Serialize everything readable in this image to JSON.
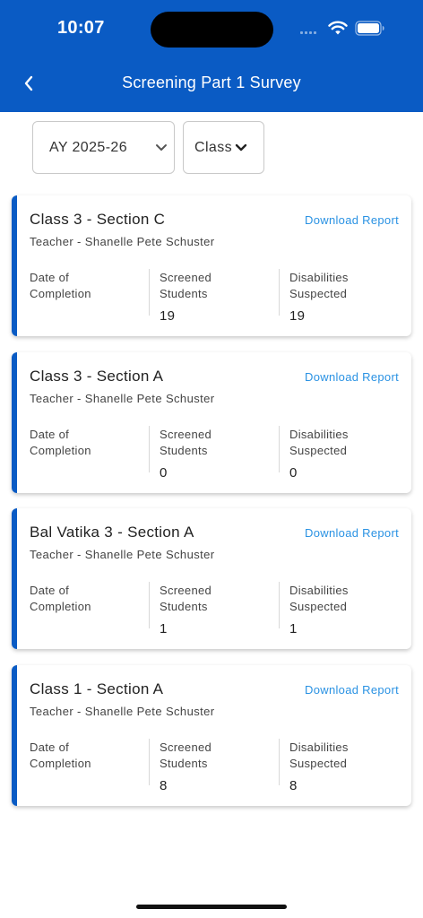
{
  "status_bar": {
    "time": "10:07"
  },
  "header": {
    "title": "Screening Part 1 Survey"
  },
  "filters": {
    "year": "AY 2025-26",
    "class": "Class"
  },
  "cards": [
    {
      "title": "Class 3 - Section C",
      "teacher": "Teacher - Shanelle Pete Schuster",
      "download": "Download Report",
      "date_label": "Date of Completion",
      "date_value": "",
      "screened_label": "Screened Students",
      "screened_value": "19",
      "disabilities_label": "Disabilities Suspected",
      "disabilities_value": "19"
    },
    {
      "title": "Class 3 - Section A",
      "teacher": "Teacher - Shanelle Pete Schuster",
      "download": "Download Report",
      "date_label": "Date of Completion",
      "date_value": "",
      "screened_label": "Screened Students",
      "screened_value": "0",
      "disabilities_label": "Disabilities Suspected",
      "disabilities_value": "0"
    },
    {
      "title": "Bal Vatika 3 - Section A",
      "teacher": "Teacher - Shanelle Pete Schuster",
      "download": "Download Report",
      "date_label": "Date of Completion",
      "date_value": "",
      "screened_label": "Screened Students",
      "screened_value": "1",
      "disabilities_label": "Disabilities Suspected",
      "disabilities_value": "1"
    },
    {
      "title": "Class 1 - Section A",
      "teacher": "Teacher - Shanelle Pete Schuster",
      "download": "Download Report",
      "date_label": "Date of Completion",
      "date_value": "",
      "screened_label": "Screened Students",
      "screened_value": "8",
      "disabilities_label": "Disabilities Suspected",
      "disabilities_value": "8"
    }
  ],
  "colors": {
    "primary": "#0a5bc4",
    "link": "#2a92e3"
  },
  "icons": [
    "back-arrow-icon",
    "chevron-down-icon",
    "wifi-icon",
    "battery-icon",
    "signal-icon"
  ]
}
